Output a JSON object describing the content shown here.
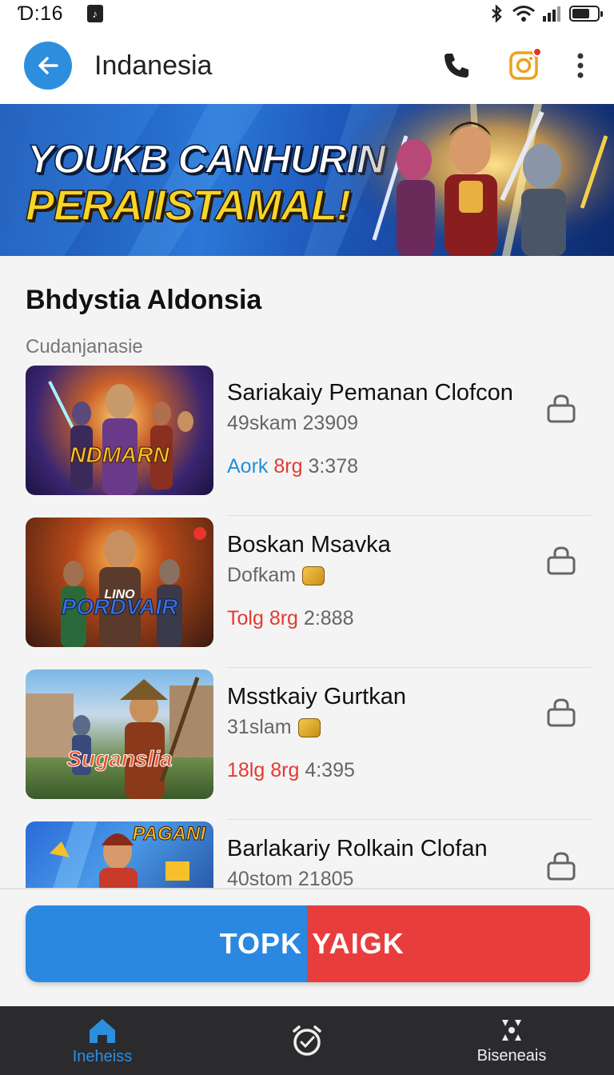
{
  "status": {
    "time": "Ɗ:16",
    "battery_level": 0.7
  },
  "header": {
    "title": "Indanesia",
    "back_icon": "arrow-left-icon",
    "phone_icon": "phone-icon",
    "camera_icon": "camera-icon",
    "menu_icon": "more-vertical-icon"
  },
  "hero": {
    "line1": "YOUKB CANHURIN",
    "line2": "PERAIISTAMAL!"
  },
  "section": {
    "title": "Bhdystia Aldonsia",
    "subtitle": "Cudanjanasie"
  },
  "items": [
    {
      "title": "Sariakaiy Pemanan Clofcon",
      "meta": "49skam 23909",
      "has_coin": false,
      "stat_a": "Aork",
      "stat_b": "8rg",
      "stat_c": "3:378",
      "thumb_label": "NDMARN",
      "thumb_label_color": "#f5c02a"
    },
    {
      "title": "Boskan Msavka",
      "meta": "Dofkam",
      "has_coin": true,
      "stat_a": "Tolg",
      "stat_b": "8rg",
      "stat_c": "2:888",
      "thumb_label": "PORDVAIR",
      "thumb_label_top": "LINO",
      "thumb_label_color": "#3b6fe0"
    },
    {
      "title": "Msstkaiy Gurtkan",
      "meta": "31slam",
      "has_coin": true,
      "stat_a": "18lg",
      "stat_b": "8rg",
      "stat_c": "4:395",
      "thumb_label": "Suganslia",
      "thumb_label_color": "#e8542c"
    },
    {
      "title": "Barlakariy Rolkain Clofan",
      "meta": "40stom 21805",
      "has_coin": false,
      "stat_a": "",
      "stat_b": "",
      "stat_c": "",
      "thumb_label": "PAGANI",
      "thumb_label_color": "#f5c02a"
    }
  ],
  "cta": {
    "left": "TOPK",
    "right": "YAIGK"
  },
  "nav": [
    {
      "label": "Ineheiss",
      "icon": "home-icon",
      "active": true
    },
    {
      "label": "",
      "icon": "alarm-icon",
      "active": false
    },
    {
      "label": "Biseneais",
      "icon": "grid-icon",
      "active": false
    }
  ],
  "colors": {
    "accent": "#2d8ede",
    "danger": "#e83d3d",
    "nav_bg": "#2b2b2e"
  }
}
